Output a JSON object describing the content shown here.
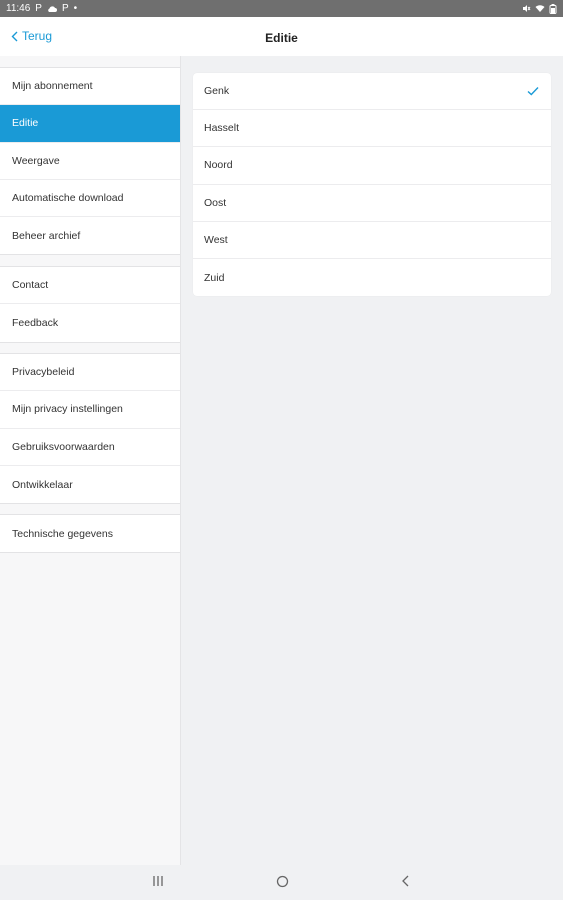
{
  "status": {
    "time": "11:46",
    "notif_icons": [
      "P",
      "cloud-icon",
      "P",
      "dot"
    ]
  },
  "nav": {
    "back_label": "Terug",
    "title": "Editie"
  },
  "sidebar": {
    "groups": [
      {
        "items": [
          {
            "label": "Mijn abonnement",
            "active": false
          },
          {
            "label": "Editie",
            "active": true
          },
          {
            "label": "Weergave",
            "active": false
          },
          {
            "label": "Automatische download",
            "active": false
          },
          {
            "label": "Beheer archief",
            "active": false
          }
        ]
      },
      {
        "items": [
          {
            "label": "Contact",
            "active": false
          },
          {
            "label": "Feedback",
            "active": false
          }
        ]
      },
      {
        "items": [
          {
            "label": "Privacybeleid",
            "active": false
          },
          {
            "label": "Mijn privacy instellingen",
            "active": false
          },
          {
            "label": "Gebruiksvoorwaarden",
            "active": false
          },
          {
            "label": "Ontwikkelaar",
            "active": false
          }
        ]
      },
      {
        "items": [
          {
            "label": "Technische gegevens",
            "active": false
          }
        ]
      }
    ]
  },
  "editions": {
    "options": [
      {
        "label": "Genk",
        "selected": true
      },
      {
        "label": "Hasselt",
        "selected": false
      },
      {
        "label": "Noord",
        "selected": false
      },
      {
        "label": "Oost",
        "selected": false
      },
      {
        "label": "West",
        "selected": false
      },
      {
        "label": "Zuid",
        "selected": false
      }
    ]
  },
  "colors": {
    "accent": "#1a9ad6",
    "status_bar": "#6f6f6f",
    "background": "#f0f1f3"
  }
}
